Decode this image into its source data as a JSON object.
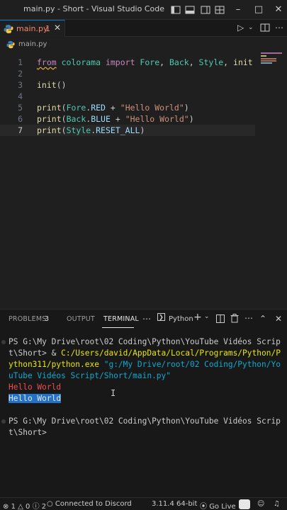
{
  "window": {
    "title": "main.py - Short - Visual Studio Code"
  },
  "tabs": [
    {
      "label": "main.py",
      "problem_count": "1",
      "icon": "python-icon"
    }
  ],
  "breadcrumb": {
    "file": "main.py"
  },
  "editor": {
    "current_line": 7,
    "line_numbers": [
      "1",
      "2",
      "3",
      "4",
      "5",
      "6",
      "7"
    ],
    "lines": [
      [
        [
          "from",
          "kw"
        ],
        [
          " colorama ",
          "cls"
        ],
        [
          "import",
          "kw"
        ],
        [
          " Fore",
          "cls"
        ],
        [
          ", ",
          ""
        ],
        [
          "Back",
          "cls"
        ],
        [
          ", ",
          ""
        ],
        [
          "Style",
          "cls"
        ],
        [
          ", ",
          ""
        ],
        [
          "init",
          "fn"
        ]
      ],
      [],
      [
        [
          "init",
          "fn"
        ],
        [
          "()",
          ""
        ]
      ],
      [],
      [
        [
          "print",
          "fn"
        ],
        [
          "(",
          ""
        ],
        [
          "Fore",
          "cls"
        ],
        [
          ".",
          ""
        ],
        [
          "RED",
          "var"
        ],
        [
          " + ",
          ""
        ],
        [
          "\"Hello World\"",
          "str"
        ],
        [
          ")",
          ""
        ]
      ],
      [
        [
          "print",
          "fn"
        ],
        [
          "(",
          ""
        ],
        [
          "Back",
          "cls"
        ],
        [
          ".",
          ""
        ],
        [
          "BLUE",
          "var"
        ],
        [
          " + ",
          ""
        ],
        [
          "\"Hello World\"",
          "str"
        ],
        [
          ")",
          ""
        ]
      ],
      [
        [
          "print",
          "fn"
        ],
        [
          "(",
          ""
        ],
        [
          "Style",
          "cls"
        ],
        [
          ".",
          ""
        ],
        [
          "RESET_ALL",
          "var"
        ],
        [
          ")",
          ""
        ]
      ]
    ]
  },
  "panel": {
    "tabs": {
      "problems": "PROBLEMS",
      "problems_count": "3",
      "output": "OUTPUT",
      "terminal": "TERMINAL"
    },
    "terminal_profile": "Python",
    "terminal": {
      "line1": "PS G:\\My Drive\\root\\02 Coding\\Python\\YouTube Vidéos Scrip",
      "line2_prefix": "t\\Short> & ",
      "line2_path": "C:/Users/david/AppData/Local/Programs/Python/P",
      "line3_path": "ython311/python.exe",
      "line3_arg": " \"g:/My Drive/root/02 Coding/Python/Yo",
      "line4_arg": "uTube Vidéos Script/Short/main.py\"",
      "red_output": "Hello World",
      "blue_output": "Hello World",
      "line7": "PS G:\\My Drive\\root\\02 Coding\\Python\\YouTube Vidéos Scrip",
      "line8": "t\\Short>"
    }
  },
  "statusbar": {
    "errors": "1",
    "warnings": "0",
    "infos": "2",
    "discord": "Connected to Discord",
    "python_version": "3.11.4 64-bit",
    "go_live": "Go Live"
  },
  "colors": {
    "accent": "#0078d4",
    "error": "#f48771",
    "terminal_red": "#f14c4c",
    "terminal_blue_bg": "#2472c8"
  }
}
